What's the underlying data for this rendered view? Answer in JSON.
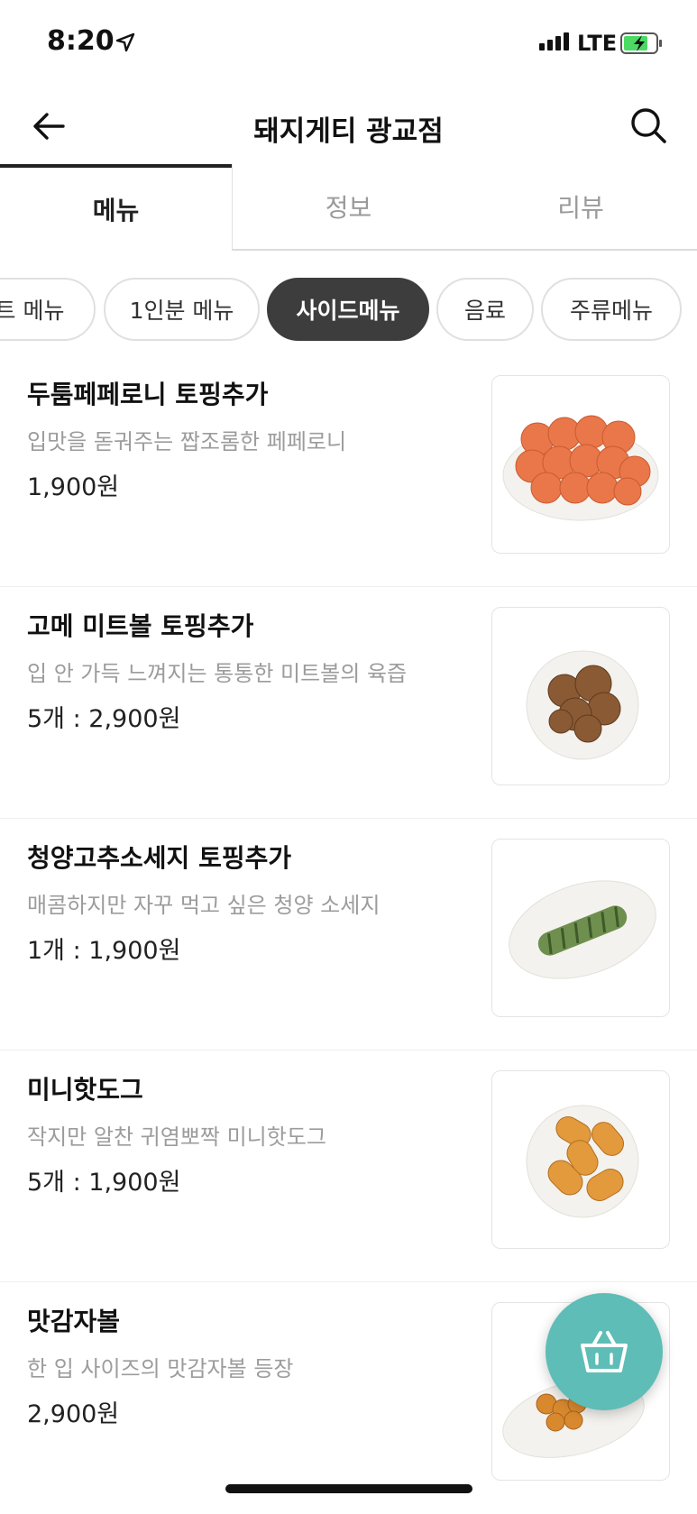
{
  "status": {
    "time": "8:20",
    "network": "LTE"
  },
  "header": {
    "title": "돼지게티 광교점"
  },
  "tabs": [
    {
      "label": "메뉴",
      "active": true
    },
    {
      "label": "정보",
      "active": false
    },
    {
      "label": "리뷰",
      "active": false
    }
  ],
  "categories": [
    {
      "label": "트 메뉴",
      "active": false
    },
    {
      "label": "1인분 메뉴",
      "active": false
    },
    {
      "label": "사이드메뉴",
      "active": true
    },
    {
      "label": "음료",
      "active": false
    },
    {
      "label": "주류메뉴",
      "active": false
    }
  ],
  "items": [
    {
      "name": "두툼페페로니 토핑추가",
      "desc": "입맛을 돋궈주는 짭조롬한 페페로니",
      "price": "1,900원"
    },
    {
      "name": "고메 미트볼 토핑추가",
      "desc": "입 안 가득 느껴지는 통통한 미트볼의 육즙",
      "price": "5개 : 2,900원"
    },
    {
      "name": "청양고추소세지 토핑추가",
      "desc": "매콤하지만 자꾸 먹고 싶은 청양 소세지",
      "price": "1개 : 1,900원"
    },
    {
      "name": "미니핫도그",
      "desc": "작지만 알찬 귀염뽀짝 미니핫도그",
      "price": "5개 : 1,900원"
    },
    {
      "name": "맛감자볼",
      "desc": "한 입 사이즈의 맛감자볼 등장",
      "price": "2,900원"
    }
  ],
  "colors": {
    "accent": "#5ebdb6",
    "active_chip": "#3d3d3d",
    "muted": "#9c9c9c"
  },
  "icons": {
    "back": "arrow-left-icon",
    "search": "search-icon",
    "cart": "basket-icon"
  }
}
